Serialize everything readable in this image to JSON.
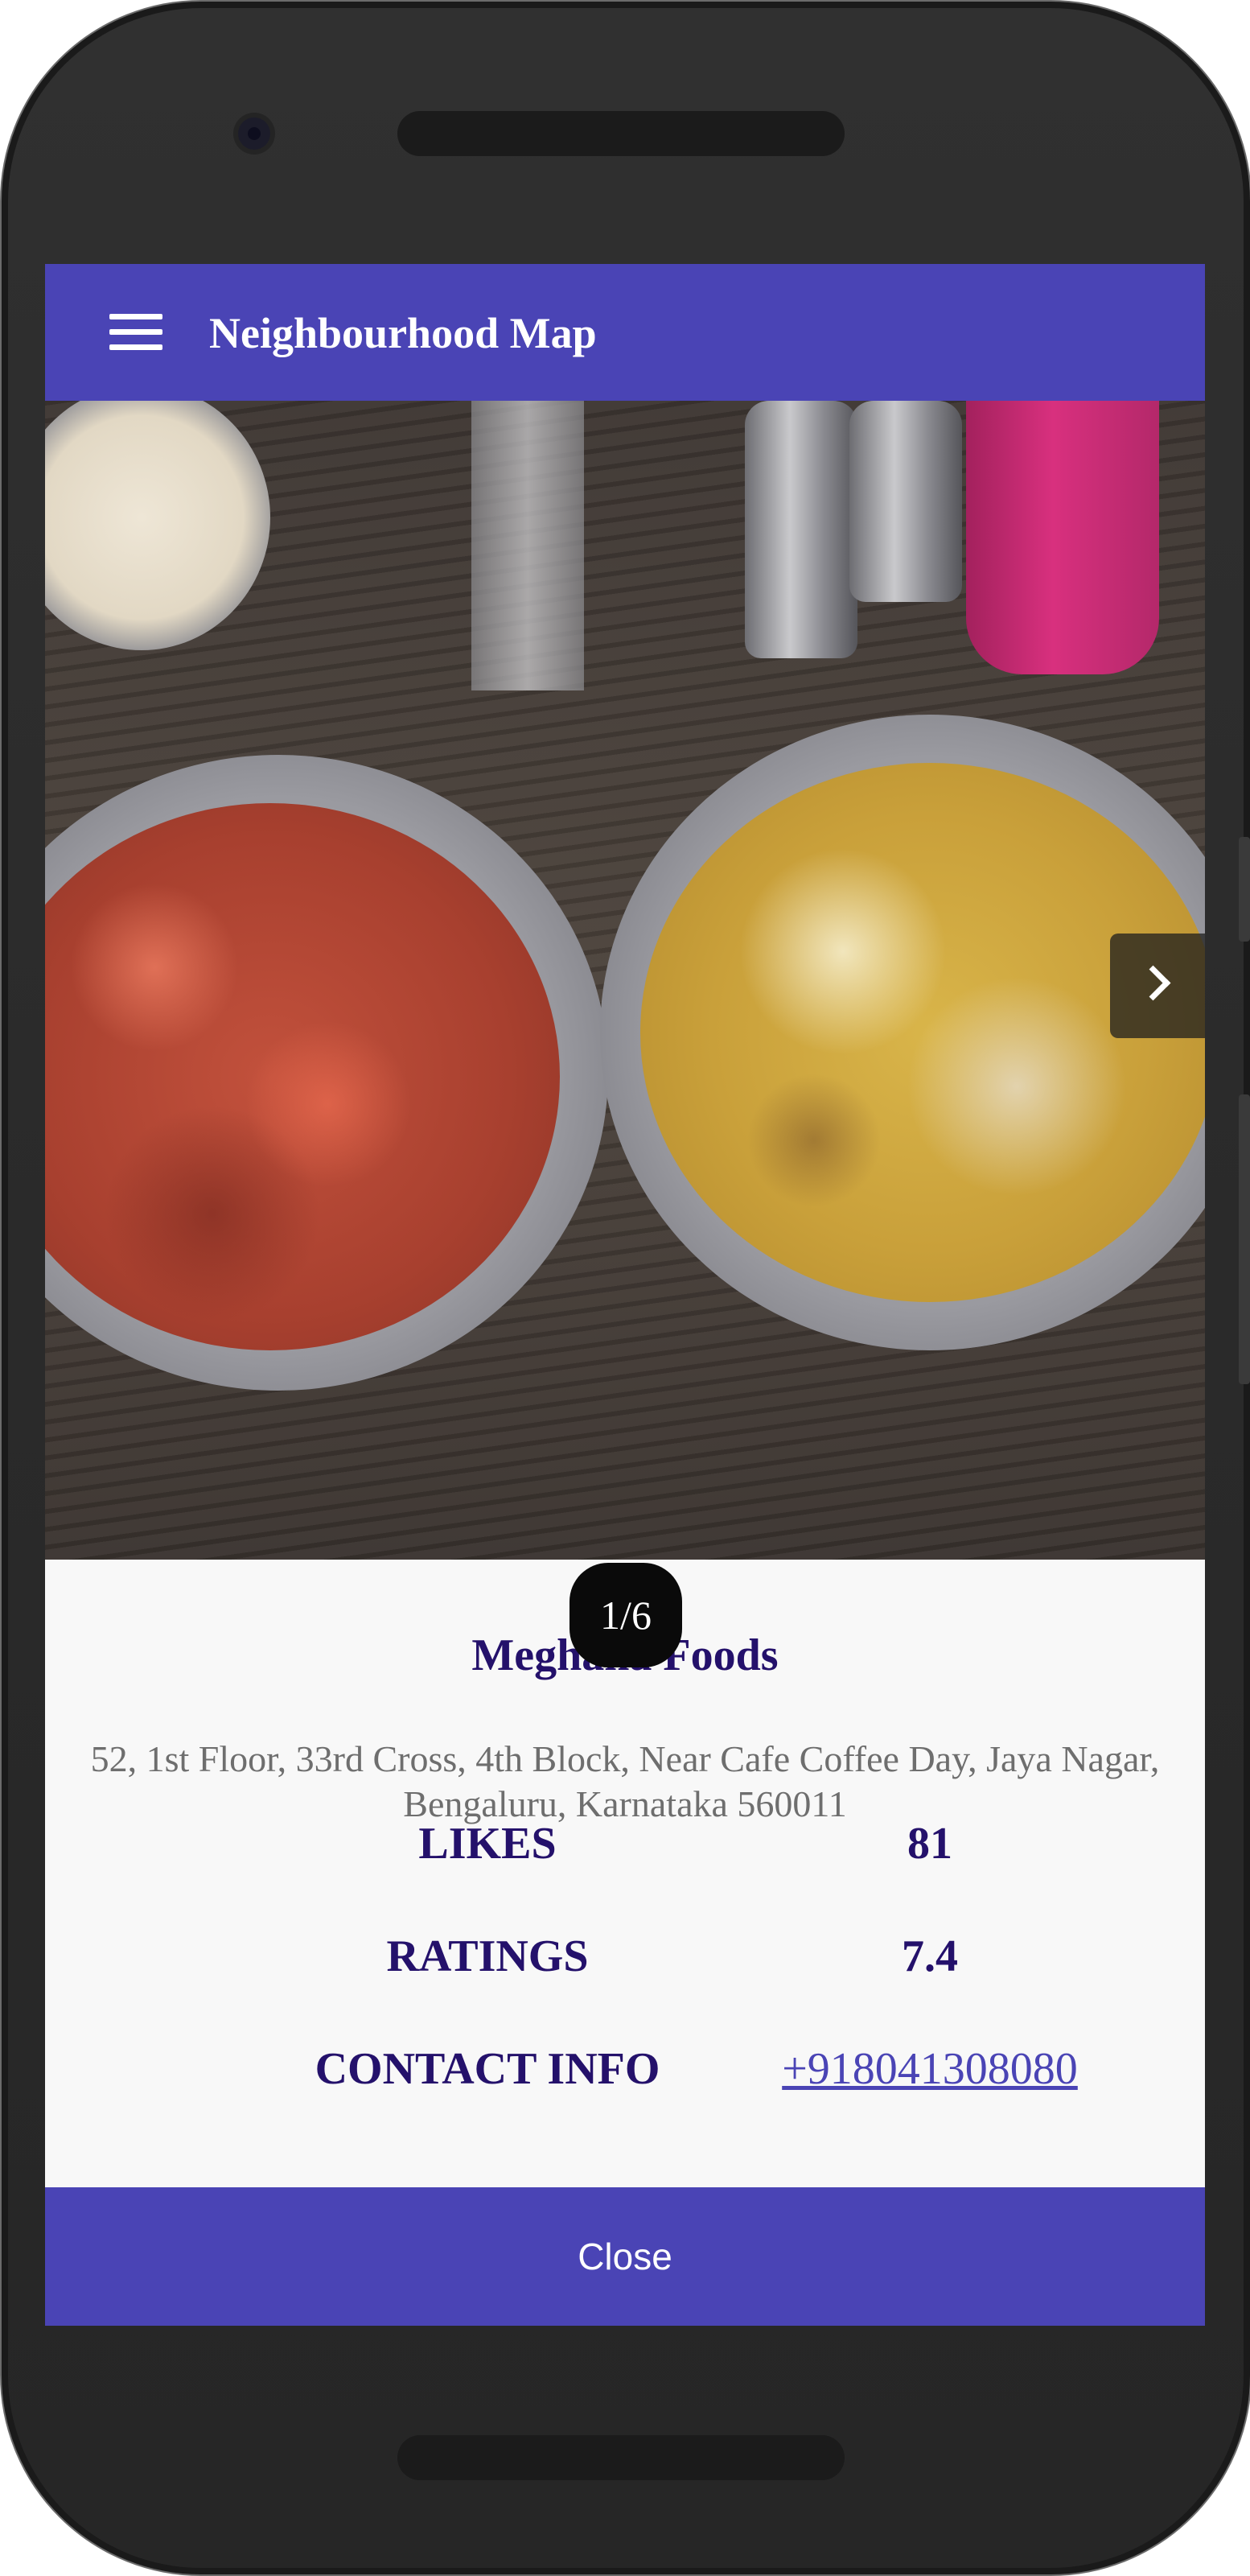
{
  "app_bar": {
    "title": "Neighbourhood Map",
    "menu_icon": "hamburger-menu-icon"
  },
  "gallery": {
    "counter": "1/6",
    "next_icon": "chevron-right-icon"
  },
  "place": {
    "name": "Meghana Foods",
    "address": "52, 1st Floor, 33rd Cross, 4th Block, Near Cafe Coffee Day, Jaya Nagar, Bengaluru, Karnataka 560011",
    "rows": [
      {
        "label": "LIKES",
        "value": "81"
      },
      {
        "label": "RATINGS",
        "value": "7.4"
      },
      {
        "label": "CONTACT INFO",
        "value": "+918041308080"
      }
    ]
  },
  "close_label": "Close",
  "colors": {
    "primary": "#4a44b5",
    "title_text": "#24116b",
    "address_text": "#6e6e6e"
  }
}
